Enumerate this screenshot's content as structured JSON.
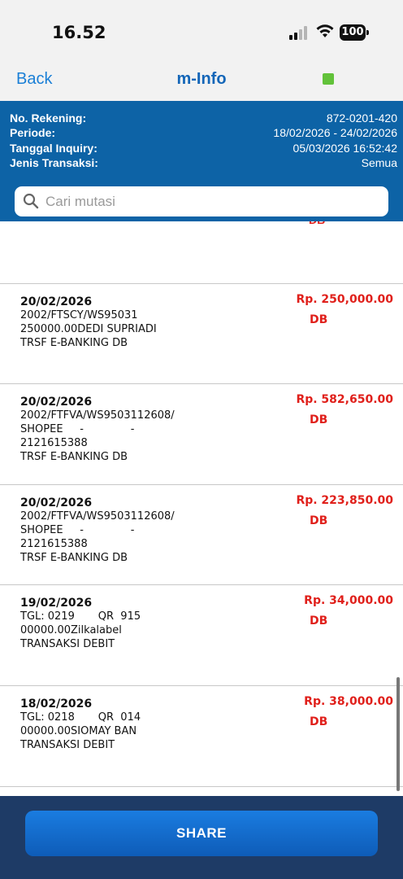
{
  "status_bar": {
    "time": "16.52",
    "battery": "100",
    "icons": [
      "signal-icon",
      "wifi-icon",
      "battery-icon"
    ]
  },
  "nav": {
    "back_label": "Back",
    "title": "m-Info",
    "status_indicator_color": "#62c23a"
  },
  "info": {
    "rows": [
      {
        "label": "No. Rekening:",
        "value": "872-0201-420"
      },
      {
        "label": "Periode:",
        "value": "18/02/2026 - 24/02/2026"
      },
      {
        "label": "Tanggal Inquiry:",
        "value": "05/03/2026 16:52:42"
      },
      {
        "label": "Jenis Transaksi:",
        "value": "Semua"
      }
    ]
  },
  "search": {
    "placeholder": "Cari mutasi",
    "value": ""
  },
  "partial_row": {
    "type": "DB"
  },
  "transactions": [
    {
      "date": "20/02/2026",
      "description": "2002/FTSCY/WS95031\n250000.00DEDI SUPRIADI\nTRSF E-BANKING DB",
      "amount": "Rp. 250,000.00",
      "type": "DB"
    },
    {
      "date": "20/02/2026",
      "description": "2002/FTFVA/WS9503112608/\nSHOPEE     -              -\n2121615388\nTRSF E-BANKING DB",
      "amount": "Rp. 582,650.00",
      "type": "DB"
    },
    {
      "date": "20/02/2026",
      "description": "2002/FTFVA/WS9503112608/\nSHOPEE     -              -\n2121615388\nTRSF E-BANKING DB",
      "amount": "Rp. 223,850.00",
      "type": "DB"
    },
    {
      "date": "19/02/2026",
      "description": "TGL: 0219       QR  915\n00000.00Zilkalabel\nTRANSAKSI DEBIT",
      "amount": "Rp. 34,000.00",
      "type": "DB"
    },
    {
      "date": "18/02/2026",
      "description": "TGL: 0218       QR  014\n00000.00SIOMAY BAN\nTRANSAKSI DEBIT",
      "amount": "Rp. 38,000.00",
      "type": "DB"
    }
  ],
  "share_label": "SHARE",
  "colors": {
    "header_blue": "#0d63a6",
    "debit_red": "#e0201b",
    "bottom_bar": "#1e3b66"
  }
}
